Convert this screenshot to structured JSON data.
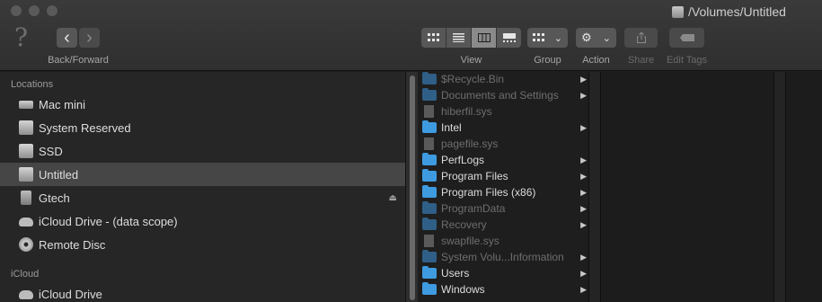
{
  "window": {
    "title": "/Volumes/Untitled"
  },
  "toolbar": {
    "nav_label": "Back/Forward",
    "view_label": "View",
    "group_label": "Group",
    "action_label": "Action",
    "share_label": "Share",
    "edit_tags_label": "Edit Tags",
    "back_glyph": "‹",
    "forward_glyph": "›",
    "help_glyph": "?"
  },
  "sidebar": {
    "locations_header": "Locations",
    "icloud_header": "iCloud",
    "locations": [
      {
        "label": "Mac mini",
        "icon": "mac-mini-icon"
      },
      {
        "label": "System Reserved",
        "icon": "disk-icon"
      },
      {
        "label": "SSD",
        "icon": "disk-icon"
      },
      {
        "label": "Untitled",
        "icon": "disk-icon",
        "selected": true
      },
      {
        "label": "Gtech",
        "icon": "external-disk-icon",
        "eject": "⏏"
      },
      {
        "label": "iCloud Drive - (data scope)",
        "icon": "cloud-icon"
      },
      {
        "label": "Remote Disc",
        "icon": "disc-icon"
      }
    ],
    "icloud": [
      {
        "label": "iCloud Drive",
        "icon": "cloud-icon"
      }
    ]
  },
  "files": [
    {
      "name": "$Recycle.Bin",
      "kind": "folder",
      "hidden": true,
      "arrow": "▶"
    },
    {
      "name": "Documents and Settings",
      "kind": "folder",
      "hidden": true,
      "arrow": "▶"
    },
    {
      "name": "hiberfil.sys",
      "kind": "file",
      "hidden": true,
      "arrow": ""
    },
    {
      "name": "Intel",
      "kind": "folder",
      "hidden": false,
      "arrow": "▶"
    },
    {
      "name": "pagefile.sys",
      "kind": "file",
      "hidden": true,
      "arrow": ""
    },
    {
      "name": "PerfLogs",
      "kind": "folder",
      "hidden": false,
      "arrow": "▶"
    },
    {
      "name": "Program Files",
      "kind": "folder",
      "hidden": false,
      "arrow": "▶"
    },
    {
      "name": "Program Files (x86)",
      "kind": "folder",
      "hidden": false,
      "arrow": "▶"
    },
    {
      "name": "ProgramData",
      "kind": "folder",
      "hidden": true,
      "arrow": "▶"
    },
    {
      "name": "Recovery",
      "kind": "folder",
      "hidden": true,
      "arrow": "▶"
    },
    {
      "name": "swapfile.sys",
      "kind": "file",
      "hidden": true,
      "arrow": ""
    },
    {
      "name": "System Volu...Information",
      "kind": "folder",
      "hidden": true,
      "arrow": "▶"
    },
    {
      "name": "Users",
      "kind": "folder",
      "hidden": false,
      "arrow": "▶"
    },
    {
      "name": "Windows",
      "kind": "folder",
      "hidden": false,
      "arrow": "▶"
    }
  ]
}
